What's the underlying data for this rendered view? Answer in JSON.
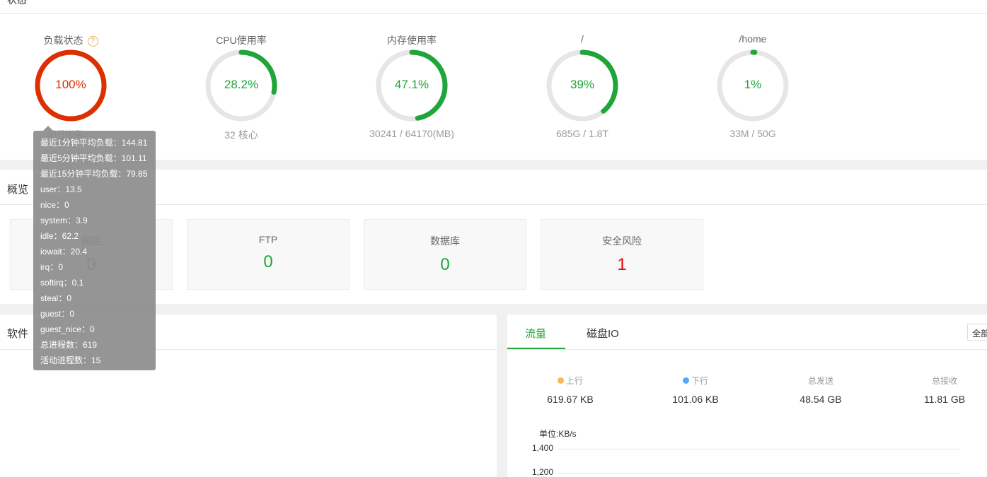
{
  "status": {
    "title": "状态",
    "gauges": [
      {
        "title": "负载状态",
        "value": "100%",
        "sub": "运行堵塞",
        "percent": 100,
        "color": "#dd2f00"
      },
      {
        "title": "CPU使用率",
        "value": "28.2%",
        "sub": "32 核心",
        "percent": 28.2,
        "color": "#20a53a"
      },
      {
        "title": "内存使用率",
        "value": "47.1%",
        "sub": "30241 / 64170(MB)",
        "percent": 47.1,
        "color": "#20a53a"
      },
      {
        "title": "/",
        "value": "39%",
        "sub": "685G / 1.8T",
        "percent": 39,
        "color": "#20a53a"
      },
      {
        "title": "/home",
        "value": "1%",
        "sub": "33M / 50G",
        "percent": 1,
        "color": "#20a53a"
      }
    ],
    "help_icon": "?"
  },
  "tooltip": {
    "lines": [
      "最近1分钟平均负载：144.81",
      "最近5分钟平均负载：101.11",
      "最近15分钟平均负载：79.85",
      "user：13.5",
      "nice：0",
      "system：3.9",
      "idle：62.2",
      "iowait：20.4",
      "irq：0",
      "softirq：0.1",
      "steal：0",
      "guest：0",
      "guest_nice：0",
      "总进程数：619",
      "活动进程数：15"
    ]
  },
  "overview": {
    "title": "概览",
    "cards": [
      {
        "label": "网站",
        "value": "0"
      },
      {
        "label": "FTP",
        "value": "0"
      },
      {
        "label": "数据库",
        "value": "0"
      },
      {
        "label": "安全风险",
        "value": "1"
      }
    ]
  },
  "software": {
    "title": "软件"
  },
  "traffic": {
    "tabs": [
      "流量",
      "磁盘IO"
    ],
    "range_select": "全部",
    "stats": [
      {
        "label": "上行",
        "value": "619.67 KB",
        "dot": "#f7b851"
      },
      {
        "label": "下行",
        "value": "101.06 KB",
        "dot": "#52a9ff"
      },
      {
        "label": "总发送",
        "value": "48.54 GB"
      },
      {
        "label": "总接收",
        "value": "11.81 GB"
      }
    ],
    "unit": "单位:KB/s",
    "y_ticks": [
      "1,400",
      "1,200"
    ]
  }
}
